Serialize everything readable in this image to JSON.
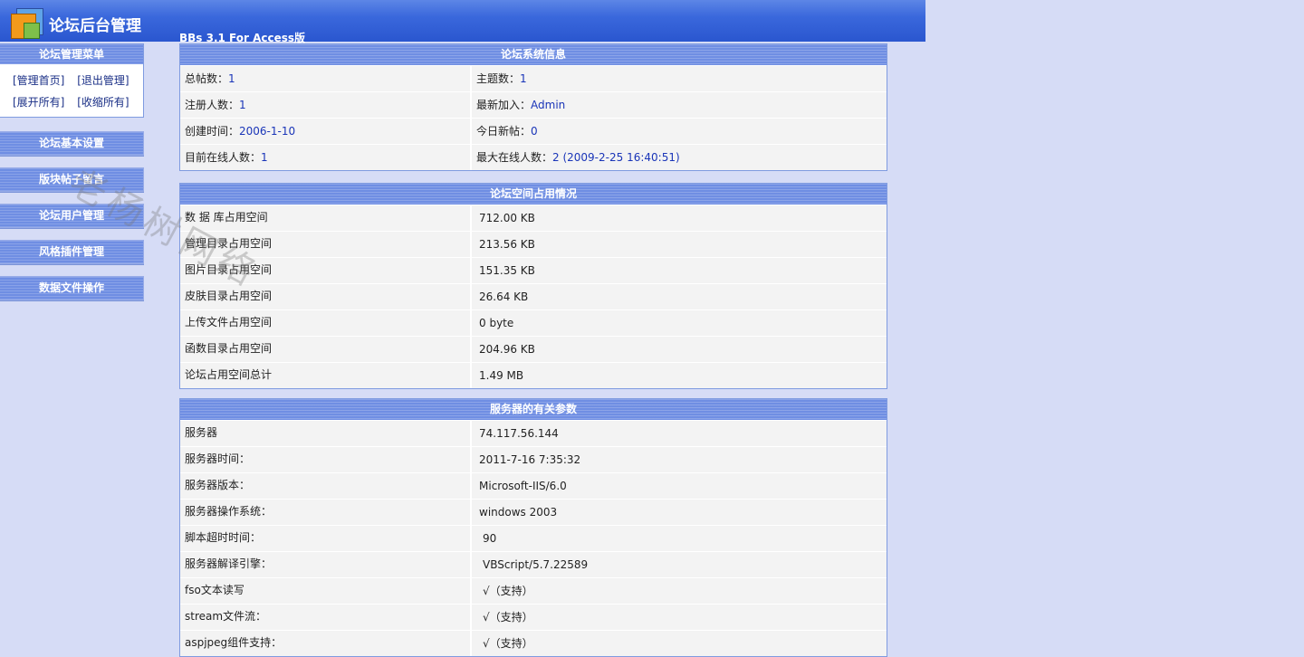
{
  "header": {
    "logo_text": "论坛后台管理",
    "version": "BBs 3.1 For Access版"
  },
  "sidebar": {
    "menu_title": "论坛管理菜单",
    "links": [
      "[管理首页]",
      "[退出管理]",
      "[展开所有]",
      "[收缩所有]"
    ],
    "sections": [
      "论坛基本设置",
      "版块帖子留言",
      "论坛用户管理",
      "风格插件管理",
      "数据文件操作"
    ]
  },
  "watermark": "老杨树网络",
  "system_info": {
    "title": "论坛系统信息",
    "rows": [
      {
        "l_label": "总帖数：",
        "l_value": "1",
        "r_label": "主题数：",
        "r_value": "1"
      },
      {
        "l_label": "注册人数：",
        "l_value": "1",
        "r_label": "最新加入：",
        "r_value": "Admin"
      },
      {
        "l_label": "创建时间：",
        "l_value": "2006-1-10",
        "r_label": "今日新帖：",
        "r_value": "0"
      },
      {
        "l_label": "目前在线人数：",
        "l_value": "1",
        "r_label": "最大在线人数：",
        "r_value": "2 (2009-2-25 16:40:51)"
      }
    ]
  },
  "space_usage": {
    "title": "论坛空间占用情况",
    "rows": [
      {
        "label": "数 据 库占用空间",
        "value": "712.00 KB"
      },
      {
        "label": "管理目录占用空间",
        "value": "213.56 KB"
      },
      {
        "label": "图片目录占用空间",
        "value": "151.35 KB"
      },
      {
        "label": "皮肤目录占用空间",
        "value": "26.64 KB"
      },
      {
        "label": "上传文件占用空间",
        "value": "0 byte"
      },
      {
        "label": "函数目录占用空间",
        "value": "204.96 KB"
      },
      {
        "label": "论坛占用空间总计",
        "value": "1.49 MB"
      }
    ]
  },
  "server_params": {
    "title": "服务器的有关参数",
    "rows": [
      {
        "label": "服务器",
        "value": "74.117.56.144"
      },
      {
        "label": "服务器时间：",
        "value": "2011-7-16 7:35:32"
      },
      {
        "label": "服务器版本：",
        "value": "Microsoft-IIS/6.0"
      },
      {
        "label": "服务器操作系统：",
        "value": "windows 2003"
      },
      {
        "label": "脚本超时时间：",
        "value": "90"
      },
      {
        "label": "服务器解译引擎：",
        "value": "VBScript/5.7.22589"
      },
      {
        "label": "fso文本读写",
        "value": "√（支持）"
      },
      {
        "label": "stream文件流：",
        "value": "√（支持）"
      },
      {
        "label": "aspjpeg组件支持：",
        "value": "√（支持）"
      }
    ]
  }
}
